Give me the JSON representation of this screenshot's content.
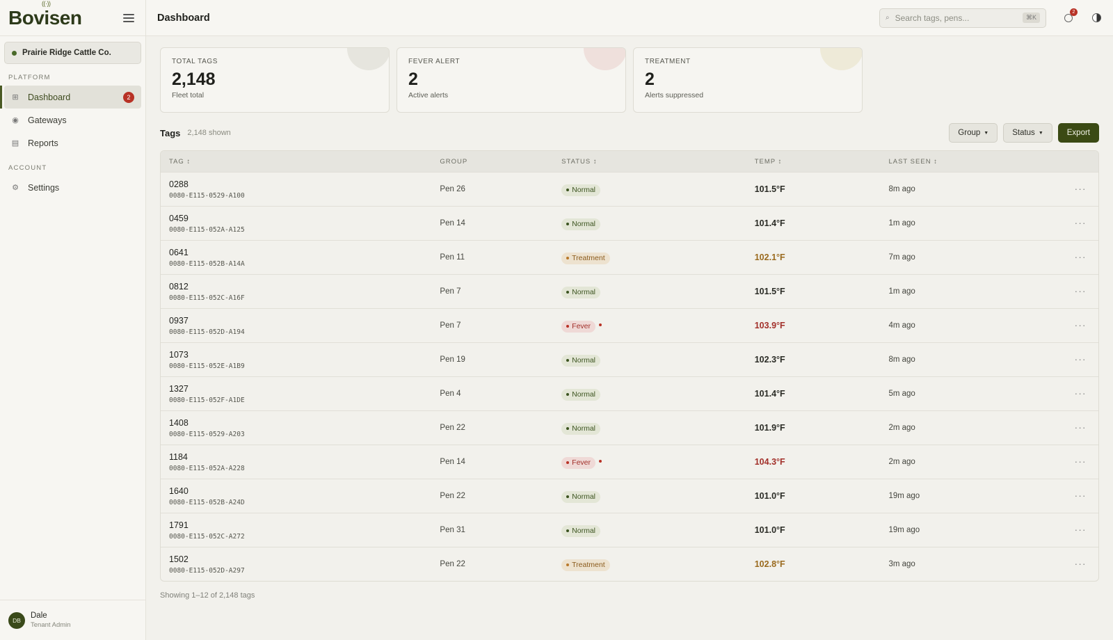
{
  "app": {
    "brand_prefix": "Bov",
    "brand_suffix": "sen",
    "brand_mark": "i"
  },
  "tenant": {
    "name": "Prairie Ridge Cattle Co."
  },
  "sidebar": {
    "platform_label": "PLATFORM",
    "account_label": "ACCOUNT",
    "items": [
      {
        "label": "Dashboard",
        "badge": "2",
        "icon": "grid-icon"
      },
      {
        "label": "Gateways",
        "icon": "radio-icon"
      },
      {
        "label": "Reports",
        "icon": "table-icon"
      }
    ],
    "account_items": [
      {
        "label": "Settings",
        "icon": "gear-icon"
      }
    ]
  },
  "user": {
    "initials": "DB",
    "name": "Dale",
    "role": "Tenant Admin"
  },
  "header": {
    "title": "Dashboard",
    "search_placeholder": "Search tags, pens...",
    "search_shortcut": "⌘K",
    "notif_count": "2"
  },
  "cards": [
    {
      "label": "TOTAL TAGS",
      "value": "2,148",
      "sub": "Fleet total",
      "color": "#e6e5de"
    },
    {
      "label": "FEVER ALERT",
      "value": "2",
      "sub": "Active alerts",
      "color": "#efe0dc"
    },
    {
      "label": "TREATMENT",
      "value": "2",
      "sub": "Alerts suppressed",
      "color": "#eeead8"
    }
  ],
  "tags": {
    "title": "Tags",
    "count": "2,148 shown",
    "group_btn": "Group",
    "status_btn": "Status",
    "export_btn": "Export",
    "columns": {
      "tag": "TAG ↕",
      "group": "GROUP",
      "status": "STATUS ↕",
      "temp": "TEMP ↕",
      "seen": "LAST SEEN ↕"
    },
    "rows": [
      {
        "id": "0288",
        "eui": "0080-E115-0529-A100",
        "group": "Pen 26",
        "status": "Normal",
        "status_class": "normal",
        "temp": "101.5°F",
        "seen": "8m ago"
      },
      {
        "id": "0459",
        "eui": "0080-E115-052A-A125",
        "group": "Pen 14",
        "status": "Normal",
        "status_class": "normal",
        "temp": "101.4°F",
        "seen": "1m ago"
      },
      {
        "id": "0641",
        "eui": "0080-E115-052B-A14A",
        "group": "Pen 11",
        "status": "Treatment",
        "status_class": "treatment",
        "temp": "102.1°F",
        "seen": "7m ago"
      },
      {
        "id": "0812",
        "eui": "0080-E115-052C-A16F",
        "group": "Pen 7",
        "status": "Normal",
        "status_class": "normal",
        "temp": "101.5°F",
        "seen": "1m ago"
      },
      {
        "id": "0937",
        "eui": "0080-E115-052D-A194",
        "group": "Pen 7",
        "status": "Fever",
        "status_class": "fever",
        "temp": "103.9°F",
        "seen": "4m ago"
      },
      {
        "id": "1073",
        "eui": "0080-E115-052E-A1B9",
        "group": "Pen 19",
        "status": "Normal",
        "status_class": "normal",
        "temp": "102.3°F",
        "seen": "8m ago"
      },
      {
        "id": "1327",
        "eui": "0080-E115-052F-A1DE",
        "group": "Pen 4",
        "status": "Normal",
        "status_class": "normal",
        "temp": "101.4°F",
        "seen": "5m ago"
      },
      {
        "id": "1408",
        "eui": "0080-E115-0529-A203",
        "group": "Pen 22",
        "status": "Normal",
        "status_class": "normal",
        "temp": "101.9°F",
        "seen": "2m ago"
      },
      {
        "id": "1184",
        "eui": "0080-E115-052A-A228",
        "group": "Pen 14",
        "status": "Fever",
        "status_class": "fever",
        "temp": "104.3°F",
        "seen": "2m ago"
      },
      {
        "id": "1640",
        "eui": "0080-E115-052B-A24D",
        "group": "Pen 22",
        "status": "Normal",
        "status_class": "normal",
        "temp": "101.0°F",
        "seen": "19m ago"
      },
      {
        "id": "1791",
        "eui": "0080-E115-052C-A272",
        "group": "Pen 31",
        "status": "Normal",
        "status_class": "normal",
        "temp": "101.0°F",
        "seen": "19m ago"
      },
      {
        "id": "1502",
        "eui": "0080-E115-052D-A297",
        "group": "Pen 22",
        "status": "Treatment",
        "status_class": "treatment",
        "temp": "102.8°F",
        "seen": "3m ago"
      }
    ],
    "row_action": "···",
    "footer": "Showing 1–12 of 2,148 tags"
  }
}
